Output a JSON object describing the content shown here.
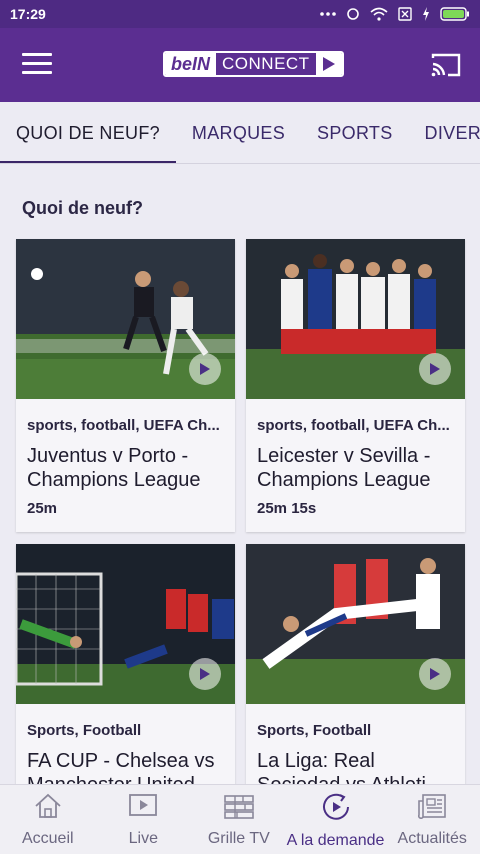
{
  "status_bar": {
    "time": "17:29"
  },
  "app": {
    "logo_left": "beIN",
    "logo_right": "CONNECT"
  },
  "tabs": [
    {
      "label": "QUOI DE NEUF?"
    },
    {
      "label": "MARQUES"
    },
    {
      "label": "SPORTS"
    },
    {
      "label": "DIVERTISS"
    }
  ],
  "section_title": "Quoi de neuf?",
  "cards": [
    {
      "tags": "sports, football, UEFA Ch...",
      "title": "Juventus v Porto - Champions League",
      "duration": "25m"
    },
    {
      "tags": "sports, football, UEFA Ch...",
      "title": "Leicester v Sevilla - Champions League",
      "duration": "25m 15s"
    },
    {
      "tags": "Sports, Football",
      "title": "FA CUP - Chelsea vs Manchester United",
      "duration": ""
    },
    {
      "tags": "Sports, Football",
      "title": "La Liga: Real Sociedad vs Athleti",
      "duration": ""
    }
  ],
  "bottom_nav": [
    {
      "label": "Accueil",
      "icon": "home-icon"
    },
    {
      "label": "Live",
      "icon": "live-play-icon"
    },
    {
      "label": "Grille TV",
      "icon": "tv-guide-icon"
    },
    {
      "label": "A la demande",
      "icon": "on-demand-icon"
    },
    {
      "label": "Actualités",
      "icon": "news-icon"
    }
  ],
  "colors": {
    "primary": "#5b2e91",
    "background": "#ecebf3",
    "active_nav": "#4a2f85"
  }
}
